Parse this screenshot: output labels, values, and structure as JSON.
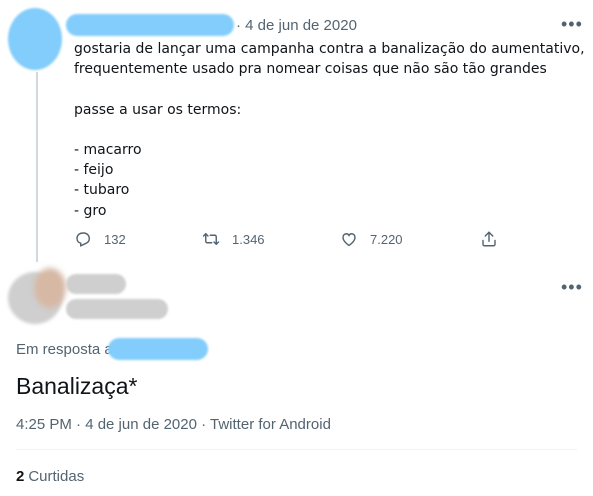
{
  "tweet1": {
    "date": "· 4 de jun de 2020",
    "more_icon": "more-horizontal-icon",
    "lines": [
      "gostaria de lançar uma campanha contra a banalização do aumentativo,",
      "frequentemente usado pra nomear coisas que não são tão grandes",
      "",
      "passe a usar os termos:",
      "",
      "- macarro",
      "- feijo",
      "- tubaro",
      "- gro"
    ],
    "actions": {
      "reply_count": "132",
      "retweet_count": "1.346",
      "like_count": "7.220"
    }
  },
  "tweet2": {
    "reply_prefix": "Em resposta a",
    "text": "Banalizaça*",
    "meta": "4:25 PM · 4 de jun de 2020 · Twitter for Android",
    "likes_count": "2",
    "likes_label": "Curtidas",
    "more_icon": "more-horizontal-icon"
  },
  "colors": {
    "text": "#0f1419",
    "secondary": "#536471",
    "blur_blue": "#82cdfc",
    "blur_gray": "#cfcfcf",
    "line": "#cfd9de"
  }
}
